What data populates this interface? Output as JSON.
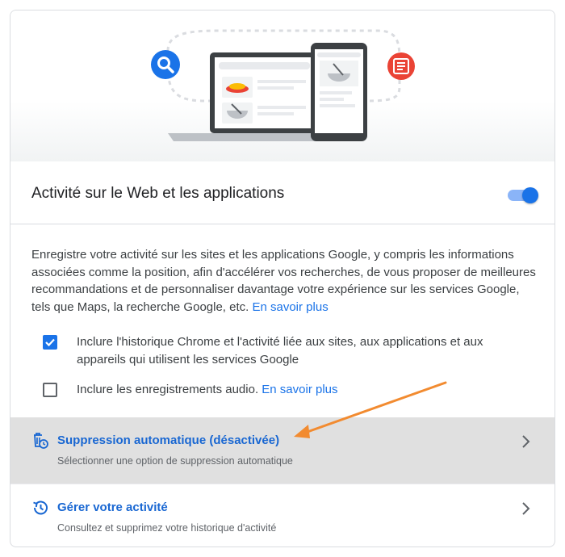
{
  "activity": {
    "title": "Activité sur le Web et les applications",
    "enabled": true,
    "description": "Enregistre votre activité sur les sites et les applications Google, y compris les informations associées comme la position, afin d'accélérer vos recherches, de vous proposer de meilleures recommandations et de personnaliser davantage votre expérience sur les services Google, tels que Maps, la recherche Google, etc.",
    "learn_more": "En savoir plus"
  },
  "options": {
    "chrome_history": {
      "label": "Inclure l'historique Chrome et l'activité liée aux sites, aux applications et aux appareils qui utilisent les services Google",
      "checked": true
    },
    "audio": {
      "label": "Inclure les enregistrements audio.",
      "checked": false,
      "learn_more": "En savoir plus"
    }
  },
  "rows": {
    "auto_delete": {
      "title": "Suppression automatique (désactivée)",
      "subtitle": "Sélectionner une option de suppression automatique",
      "icon": "auto-delete-icon"
    },
    "manage": {
      "title": "Gérer votre activité",
      "subtitle": "Consultez et supprimez votre historique d'activité",
      "icon": "history-icon"
    }
  },
  "colors": {
    "accent": "#1a73e8",
    "link": "#1967d2",
    "highlight_row": "#e0e0e0",
    "annotation_arrow": "#f28b30"
  }
}
